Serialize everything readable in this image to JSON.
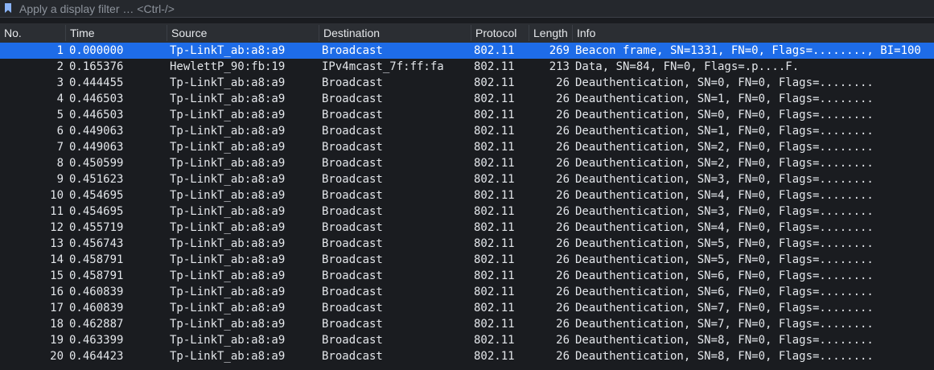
{
  "filter": {
    "placeholder": "Apply a display filter … <Ctrl-/>",
    "value": ""
  },
  "columns": [
    "No.",
    "Time",
    "Source",
    "Destination",
    "Protocol",
    "Length",
    "Info"
  ],
  "selected_row": 0,
  "packets": [
    {
      "no": "1",
      "time": "0.000000",
      "source": "Tp-LinkT_ab:a8:a9",
      "destination": "Broadcast",
      "protocol": "802.11",
      "length": "269",
      "info": "Beacon frame, SN=1331, FN=0, Flags=........, BI=100"
    },
    {
      "no": "2",
      "time": "0.165376",
      "source": "HewlettP_90:fb:19",
      "destination": "IPv4mcast_7f:ff:fa",
      "protocol": "802.11",
      "length": "213",
      "info": "Data, SN=84, FN=0, Flags=.p....F."
    },
    {
      "no": "3",
      "time": "0.444455",
      "source": "Tp-LinkT_ab:a8:a9",
      "destination": "Broadcast",
      "protocol": "802.11",
      "length": "26",
      "info": "Deauthentication, SN=0, FN=0, Flags=........"
    },
    {
      "no": "4",
      "time": "0.446503",
      "source": "Tp-LinkT_ab:a8:a9",
      "destination": "Broadcast",
      "protocol": "802.11",
      "length": "26",
      "info": "Deauthentication, SN=1, FN=0, Flags=........"
    },
    {
      "no": "5",
      "time": "0.446503",
      "source": "Tp-LinkT_ab:a8:a9",
      "destination": "Broadcast",
      "protocol": "802.11",
      "length": "26",
      "info": "Deauthentication, SN=0, FN=0, Flags=........"
    },
    {
      "no": "6",
      "time": "0.449063",
      "source": "Tp-LinkT_ab:a8:a9",
      "destination": "Broadcast",
      "protocol": "802.11",
      "length": "26",
      "info": "Deauthentication, SN=1, FN=0, Flags=........"
    },
    {
      "no": "7",
      "time": "0.449063",
      "source": "Tp-LinkT_ab:a8:a9",
      "destination": "Broadcast",
      "protocol": "802.11",
      "length": "26",
      "info": "Deauthentication, SN=2, FN=0, Flags=........"
    },
    {
      "no": "8",
      "time": "0.450599",
      "source": "Tp-LinkT_ab:a8:a9",
      "destination": "Broadcast",
      "protocol": "802.11",
      "length": "26",
      "info": "Deauthentication, SN=2, FN=0, Flags=........"
    },
    {
      "no": "9",
      "time": "0.451623",
      "source": "Tp-LinkT_ab:a8:a9",
      "destination": "Broadcast",
      "protocol": "802.11",
      "length": "26",
      "info": "Deauthentication, SN=3, FN=0, Flags=........"
    },
    {
      "no": "10",
      "time": "0.454695",
      "source": "Tp-LinkT_ab:a8:a9",
      "destination": "Broadcast",
      "protocol": "802.11",
      "length": "26",
      "info": "Deauthentication, SN=4, FN=0, Flags=........"
    },
    {
      "no": "11",
      "time": "0.454695",
      "source": "Tp-LinkT_ab:a8:a9",
      "destination": "Broadcast",
      "protocol": "802.11",
      "length": "26",
      "info": "Deauthentication, SN=3, FN=0, Flags=........"
    },
    {
      "no": "12",
      "time": "0.455719",
      "source": "Tp-LinkT_ab:a8:a9",
      "destination": "Broadcast",
      "protocol": "802.11",
      "length": "26",
      "info": "Deauthentication, SN=4, FN=0, Flags=........"
    },
    {
      "no": "13",
      "time": "0.456743",
      "source": "Tp-LinkT_ab:a8:a9",
      "destination": "Broadcast",
      "protocol": "802.11",
      "length": "26",
      "info": "Deauthentication, SN=5, FN=0, Flags=........"
    },
    {
      "no": "14",
      "time": "0.458791",
      "source": "Tp-LinkT_ab:a8:a9",
      "destination": "Broadcast",
      "protocol": "802.11",
      "length": "26",
      "info": "Deauthentication, SN=5, FN=0, Flags=........"
    },
    {
      "no": "15",
      "time": "0.458791",
      "source": "Tp-LinkT_ab:a8:a9",
      "destination": "Broadcast",
      "protocol": "802.11",
      "length": "26",
      "info": "Deauthentication, SN=6, FN=0, Flags=........"
    },
    {
      "no": "16",
      "time": "0.460839",
      "source": "Tp-LinkT_ab:a8:a9",
      "destination": "Broadcast",
      "protocol": "802.11",
      "length": "26",
      "info": "Deauthentication, SN=6, FN=0, Flags=........"
    },
    {
      "no": "17",
      "time": "0.460839",
      "source": "Tp-LinkT_ab:a8:a9",
      "destination": "Broadcast",
      "protocol": "802.11",
      "length": "26",
      "info": "Deauthentication, SN=7, FN=0, Flags=........"
    },
    {
      "no": "18",
      "time": "0.462887",
      "source": "Tp-LinkT_ab:a8:a9",
      "destination": "Broadcast",
      "protocol": "802.11",
      "length": "26",
      "info": "Deauthentication, SN=7, FN=0, Flags=........"
    },
    {
      "no": "19",
      "time": "0.463399",
      "source": "Tp-LinkT_ab:a8:a9",
      "destination": "Broadcast",
      "protocol": "802.11",
      "length": "26",
      "info": "Deauthentication, SN=8, FN=0, Flags=........"
    },
    {
      "no": "20",
      "time": "0.464423",
      "source": "Tp-LinkT_ab:a8:a9",
      "destination": "Broadcast",
      "protocol": "802.11",
      "length": "26",
      "info": "Deauthentication, SN=8, FN=0, Flags=........"
    }
  ],
  "colors": {
    "background": "#1a1c20",
    "header": "#2b2e33",
    "selected": "#1e6ce8",
    "bookmark": "#8ab4f8"
  },
  "icons": {
    "filter_bookmark": "bookmark-icon"
  }
}
